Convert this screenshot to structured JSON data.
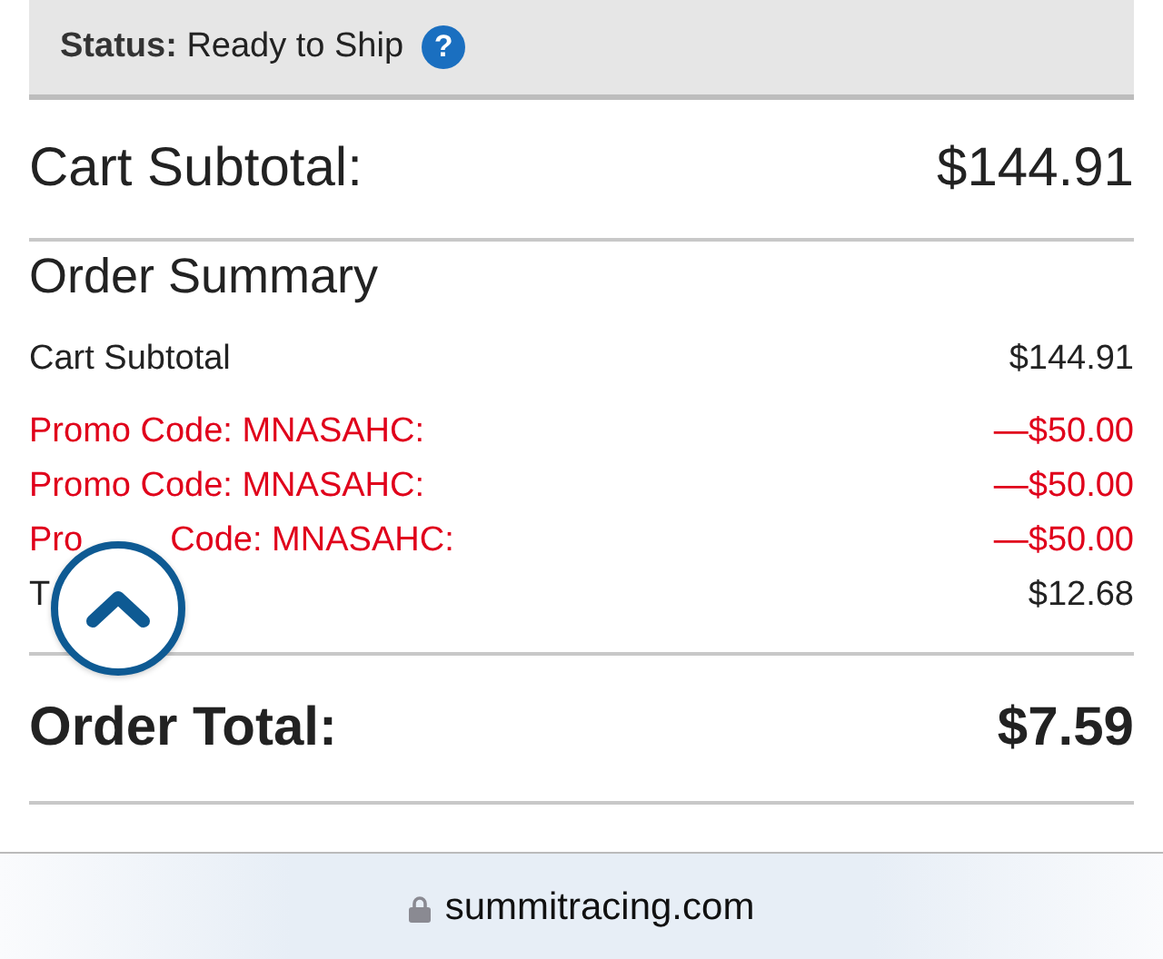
{
  "status": {
    "label": "Status:",
    "value": "Ready to Ship",
    "help": "?"
  },
  "cart_subtotal": {
    "label": "Cart Subtotal:",
    "value": "$144.91"
  },
  "order_summary": {
    "title": "Order Summary",
    "rows": [
      {
        "kind": "normal",
        "label_parts": [
          "Cart Subtotal"
        ],
        "value": "$144.91"
      },
      {
        "kind": "discount",
        "label_parts": [
          "Promo Code: MNASAHC:"
        ],
        "value": "—$50.00"
      },
      {
        "kind": "discount",
        "label_parts": [
          "Promo Code: MNASAHC:"
        ],
        "value": "—$50.00"
      },
      {
        "kind": "discount",
        "label_parts": [
          "Pro",
          "Code: MNASAHC:"
        ],
        "value": "—$50.00"
      },
      {
        "kind": "normal",
        "label_parts": [
          "T"
        ],
        "value": "$12.68"
      }
    ]
  },
  "order_total": {
    "label": "Order Total:",
    "value": "$7.59"
  },
  "address_bar": {
    "url": "summitracing.com"
  }
}
